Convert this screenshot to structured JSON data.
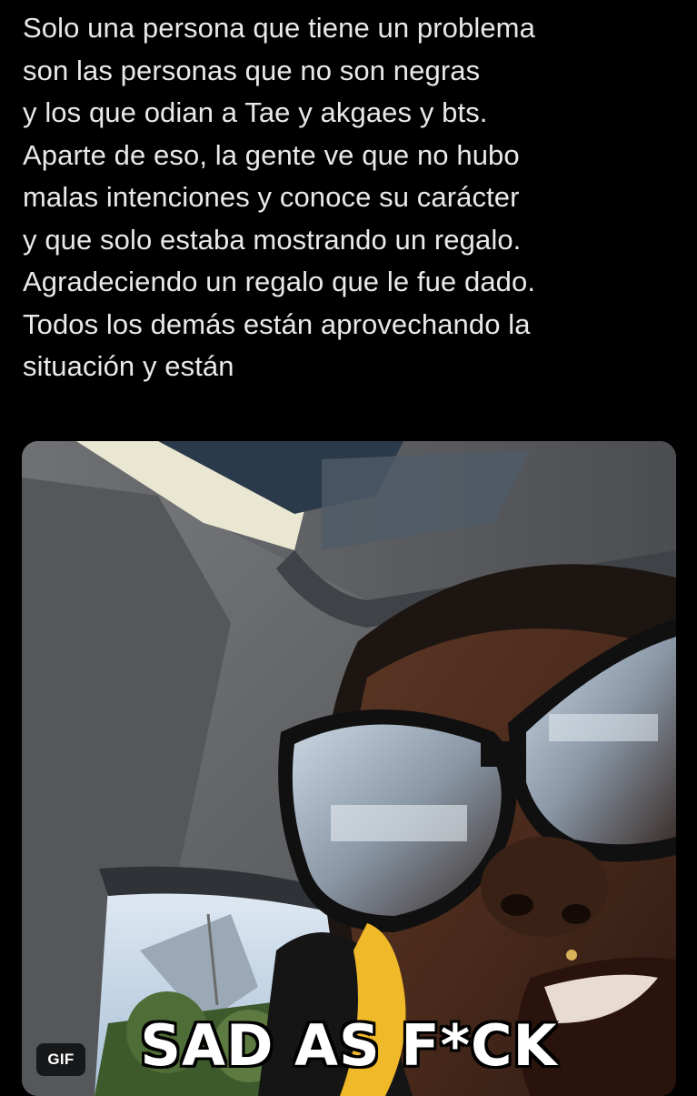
{
  "tweet": {
    "text_lines": [
      "Solo una persona que tiene un problema",
      "son las personas que no son negras",
      "y los que odian a Tae y akgaes y bts.",
      "Aparte de eso, la gente ve que no hubo",
      "malas intenciones y conoce su carácter",
      "y que solo estaba mostrando un regalo.",
      "Agradeciendo un regalo que le fue dado.",
      "Todos los demás están aprovechando la",
      "situación y están"
    ]
  },
  "media": {
    "type_badge": "GIF",
    "caption": "SAD AS F*CK"
  },
  "colors": {
    "background": "#000000",
    "text": "#e7e9ea"
  }
}
